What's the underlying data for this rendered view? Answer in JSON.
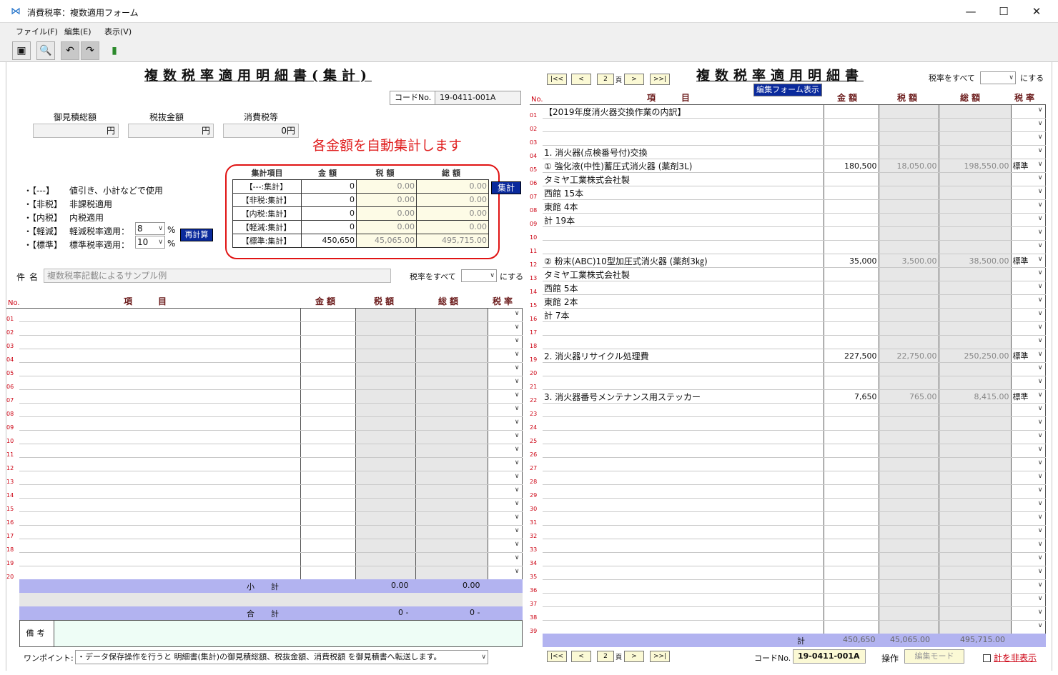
{
  "window": {
    "title": "消費税率：複数適用フォーム",
    "min": "—",
    "max": "☐",
    "close": "✕"
  },
  "menu": [
    "ファイル(F)",
    "編集(E)",
    "表示(V)"
  ],
  "left": {
    "title": "複数税率適用明細書(集計)",
    "code_label": "コードNo.",
    "code_value": "19-0411-001A",
    "estimate_total_label": "御見積総額",
    "pretax_label": "税抜金額",
    "tax_label": "消費税等",
    "estimate_total": "円",
    "pretax": "円",
    "tax": "0円",
    "annotation": "各金額を自動集計します",
    "summary_headers": [
      "集計項目",
      "金額",
      "税額",
      "総額"
    ],
    "summary_rows": [
      {
        "label": "【---:集計】",
        "amount": "0",
        "tax": "0.00",
        "total": "0.00"
      },
      {
        "label": "【非税:集計】",
        "amount": "0",
        "tax": "0.00",
        "total": "0.00"
      },
      {
        "label": "【内税:集計】",
        "amount": "0",
        "tax": "0.00",
        "total": "0.00"
      },
      {
        "label": "【軽減:集計】",
        "amount": "0",
        "tax": "0.00",
        "total": "0.00"
      },
      {
        "label": "【標準:集計】",
        "amount": "450,650",
        "tax": "45,065.00",
        "total": "495,715.00"
      }
    ],
    "total_button": "集計",
    "recalc_button": "再計算",
    "legend": [
      {
        "key": "・【---】",
        "text": "値引き、小計などで使用"
      },
      {
        "key": "・【非税】",
        "text": "非課税適用"
      },
      {
        "key": "・【内税】",
        "text": "内税適用"
      },
      {
        "key": "・【軽減】",
        "text": "軽減税率適用："
      },
      {
        "key": "・【標準】",
        "text": "標準税率適用："
      }
    ],
    "reduced_rate": "8",
    "standard_rate": "10",
    "percent": "%",
    "subject_label": "件名",
    "subject_value": "複数税率記載によるサンプル例",
    "rate_all_label": "税率をすべて",
    "rate_all_suffix": "にする",
    "col_no": "No.",
    "col_item": "項　　目",
    "col_amount": "金額",
    "col_tax": "税額",
    "col_total": "総額",
    "col_rate": "税率",
    "subtotal_label": "小　計",
    "subtotal_tax": "0.00",
    "subtotal_total": "0.00",
    "grand_label": "合　計",
    "grand_tax": "0 -",
    "grand_total": "0 -",
    "notes_label": "備考",
    "onepoint_label": "ワンポイント:",
    "onepoint_text": "・データ保存操作を行うと 明細書(集計)の御見積総額、税抜金額、消費税額 を御見積書へ転送します。"
  },
  "right": {
    "title": "複数税率適用明細書",
    "page": "2",
    "page_unit": "頁",
    "nav": [
      "|<<",
      "<",
      ">",
      ">>|"
    ],
    "edit_form_button": "編集フォーム表示",
    "rate_all_label": "税率をすべて",
    "rate_all_suffix": "にする",
    "col_no": "No.",
    "col_item": "項　　目",
    "col_amount": "金額",
    "col_tax": "税額",
    "col_total": "総額",
    "col_rate": "税率",
    "rows": [
      {
        "no": "01",
        "item": "【2019年度消火器交換作業の内訳】",
        "amount": "",
        "tax": "",
        "total": "",
        "rate": ""
      },
      {
        "no": "02",
        "item": "",
        "amount": "",
        "tax": "",
        "total": "",
        "rate": ""
      },
      {
        "no": "03",
        "item": "",
        "amount": "",
        "tax": "",
        "total": "",
        "rate": ""
      },
      {
        "no": "04",
        "item": "1. 消火器(点検番号付)交換",
        "amount": "",
        "tax": "",
        "total": "",
        "rate": ""
      },
      {
        "no": "05",
        "item": " ① 強化液(中性)蓄圧式消火器 (薬剤3L)",
        "amount": "180,500",
        "tax": "18,050.00",
        "total": "198,550.00",
        "rate": "標準"
      },
      {
        "no": "06",
        "item": "       タミヤ工業株式会社製",
        "amount": "",
        "tax": "",
        "total": "",
        "rate": ""
      },
      {
        "no": "07",
        "item": "           西館          15本",
        "amount": "",
        "tax": "",
        "total": "",
        "rate": ""
      },
      {
        "no": "08",
        "item": "           東館            4本",
        "amount": "",
        "tax": "",
        "total": "",
        "rate": ""
      },
      {
        "no": "09",
        "item": "             計          19本",
        "amount": "",
        "tax": "",
        "total": "",
        "rate": ""
      },
      {
        "no": "10",
        "item": "",
        "amount": "",
        "tax": "",
        "total": "",
        "rate": ""
      },
      {
        "no": "11",
        "item": "",
        "amount": "",
        "tax": "",
        "total": "",
        "rate": ""
      },
      {
        "no": "12",
        "item": " ② 粉末(ABC)10型加圧式消火器 (薬剤3㎏)",
        "amount": "35,000",
        "tax": "3,500.00",
        "total": "38,500.00",
        "rate": "標準"
      },
      {
        "no": "13",
        "item": "       タミヤ工業株式会社製",
        "amount": "",
        "tax": "",
        "total": "",
        "rate": ""
      },
      {
        "no": "14",
        "item": "           西館            5本",
        "amount": "",
        "tax": "",
        "total": "",
        "rate": ""
      },
      {
        "no": "15",
        "item": "           東館            2本",
        "amount": "",
        "tax": "",
        "total": "",
        "rate": ""
      },
      {
        "no": "16",
        "item": "             計            7本",
        "amount": "",
        "tax": "",
        "total": "",
        "rate": ""
      },
      {
        "no": "17",
        "item": "",
        "amount": "",
        "tax": "",
        "total": "",
        "rate": ""
      },
      {
        "no": "18",
        "item": "",
        "amount": "",
        "tax": "",
        "total": "",
        "rate": ""
      },
      {
        "no": "19",
        "item": "2.  消火器リサイクル処理費",
        "amount": "227,500",
        "tax": "22,750.00",
        "total": "250,250.00",
        "rate": "標準"
      },
      {
        "no": "20",
        "item": "",
        "amount": "",
        "tax": "",
        "total": "",
        "rate": ""
      },
      {
        "no": "21",
        "item": "",
        "amount": "",
        "tax": "",
        "total": "",
        "rate": ""
      },
      {
        "no": "22",
        "item": "3. 消火器番号メンテナンス用ステッカー",
        "amount": "7,650",
        "tax": "765.00",
        "total": "8,415.00",
        "rate": "標準"
      }
    ],
    "total_label": "計",
    "total_amount": "450,650",
    "total_tax": "45,065.00",
    "total_total": "495,715.00",
    "code_label": "コードNo.",
    "code_value": "19-0411-001A",
    "op_label": "操作",
    "op_value": "編集モード",
    "hide_total": "計を非表示"
  }
}
